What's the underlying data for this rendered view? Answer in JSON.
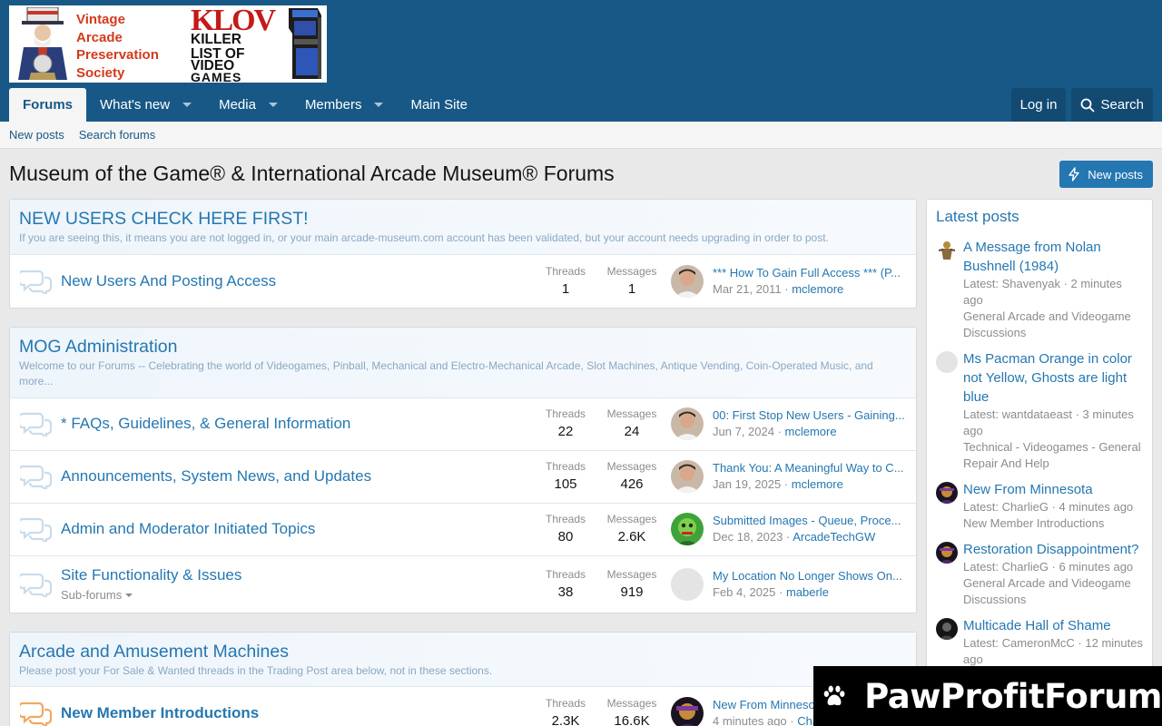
{
  "logo": {
    "vaps_lines": [
      "Vintage",
      "Arcade",
      "Preservation",
      "Society"
    ],
    "klov_big": "KLOV",
    "klov_lines": [
      "KILLER",
      "LIST OF",
      "VIDEO",
      "GAMES"
    ]
  },
  "nav": {
    "tabs": [
      {
        "label": "Forums",
        "active": true,
        "caret": false
      },
      {
        "label": "What's new",
        "active": false,
        "caret": true
      },
      {
        "label": "Media",
        "active": false,
        "caret": true
      },
      {
        "label": "Members",
        "active": false,
        "caret": true
      },
      {
        "label": "Main Site",
        "active": false,
        "caret": false
      }
    ],
    "login": "Log in",
    "search": "Search"
  },
  "subnav": {
    "new_posts": "New posts",
    "search_forums": "Search forums"
  },
  "page": {
    "title": "Museum of the Game® & International Arcade Museum® Forums",
    "new_posts_button": "New posts"
  },
  "categories": [
    {
      "title": "NEW USERS CHECK HERE FIRST!",
      "desc": "If you are seeing this, it means you are not logged in, or your main arcade-museum.com account has been validated, but your account needs upgrading in order to post.",
      "nodes": [
        {
          "title": "New Users And Posting Access",
          "threads_label": "Threads",
          "threads": "1",
          "messages_label": "Messages",
          "messages": "1",
          "last_title": "*** How To Gain Full Access *** (P...",
          "last_date": "Mar 21, 2011",
          "last_user": "mclemore",
          "avatar": "photo",
          "unread": false
        }
      ]
    },
    {
      "title": "MOG Administration",
      "desc": "Welcome to our Forums -- Celebrating the world of Videogames, Pinball, Mechanical and Electro-Mechanical Arcade, Slot Machines, Antique Vending, Coin-Operated Music, and more...",
      "nodes": [
        {
          "title": "* FAQs, Guidelines, & General Information",
          "threads_label": "Threads",
          "threads": "22",
          "messages_label": "Messages",
          "messages": "24",
          "last_title": "00: First Stop New Users - Gaining...",
          "last_date": "Jun 7, 2024",
          "last_user": "mclemore",
          "avatar": "photo",
          "unread": false
        },
        {
          "title": "Announcements, System News, and Updates",
          "threads_label": "Threads",
          "threads": "105",
          "messages_label": "Messages",
          "messages": "426",
          "last_title": "Thank You: A Meaningful Way to C...",
          "last_date": "Jan 19, 2025",
          "last_user": "mclemore",
          "avatar": "photo",
          "unread": false
        },
        {
          "title": "Admin and Moderator Initiated Topics",
          "threads_label": "Threads",
          "threads": "80",
          "messages_label": "Messages",
          "messages": "2.6K",
          "last_title": "Submitted Images - Queue, Proce...",
          "last_date": "Dec 18, 2023",
          "last_user": "ArcadeTechGW",
          "avatar": "green",
          "unread": false
        },
        {
          "title": "Site Functionality & Issues",
          "sub": "Sub-forums",
          "threads_label": "Threads",
          "threads": "38",
          "messages_label": "Messages",
          "messages": "919",
          "last_title": "My Location No Longer Shows On...",
          "last_date": "Feb 4, 2025",
          "last_user": "maberle",
          "avatar": "blank",
          "unread": false
        }
      ]
    },
    {
      "title": "Arcade and Amusement Machines",
      "desc": "Please post your For Sale & Wanted threads in the Trading Post area below, not in these sections.",
      "nodes": [
        {
          "title": "New Member Introductions",
          "threads_label": "Threads",
          "threads": "2.3K",
          "messages_label": "Messages",
          "messages": "16.6K",
          "last_title": "New From Minnesota",
          "last_date": "4 minutes ago",
          "last_user": "CharlieG",
          "avatar": "dark",
          "unread": true
        }
      ]
    }
  ],
  "sidebar": {
    "title": "Latest posts",
    "items": [
      {
        "title": "A Message from Nolan Bushnell (1984)",
        "latest": "Latest: Shavenyak · 2 minutes ago",
        "forum": "General Arcade and Videogame Discussions",
        "avatar": "figure"
      },
      {
        "title": "Ms Pacman Orange in color not Yellow, Ghosts are light blue",
        "latest": "Latest: wantdataeast · 3 minutes ago",
        "forum": "Technical - Videogames - General Repair And Help",
        "avatar": "blank"
      },
      {
        "title": "New From Minnesota",
        "latest": "Latest: CharlieG · 4 minutes ago",
        "forum": "New Member Introductions",
        "avatar": "dark"
      },
      {
        "title": "Restoration Disappointment?",
        "latest": "Latest: CharlieG · 6 minutes ago",
        "forum": "General Arcade and Videogame Discussions",
        "avatar": "dark"
      },
      {
        "title": "Multicade Hall of Shame",
        "latest": "Latest: CameronMcC · 12 minutes ago",
        "forum": "",
        "avatar": "black"
      }
    ]
  },
  "watermark": {
    "text": "PawProfitForum"
  },
  "colors": {
    "header": "#185886",
    "link": "#2577b1",
    "button": "#2577b1",
    "unread_icon": "#f0a860"
  }
}
